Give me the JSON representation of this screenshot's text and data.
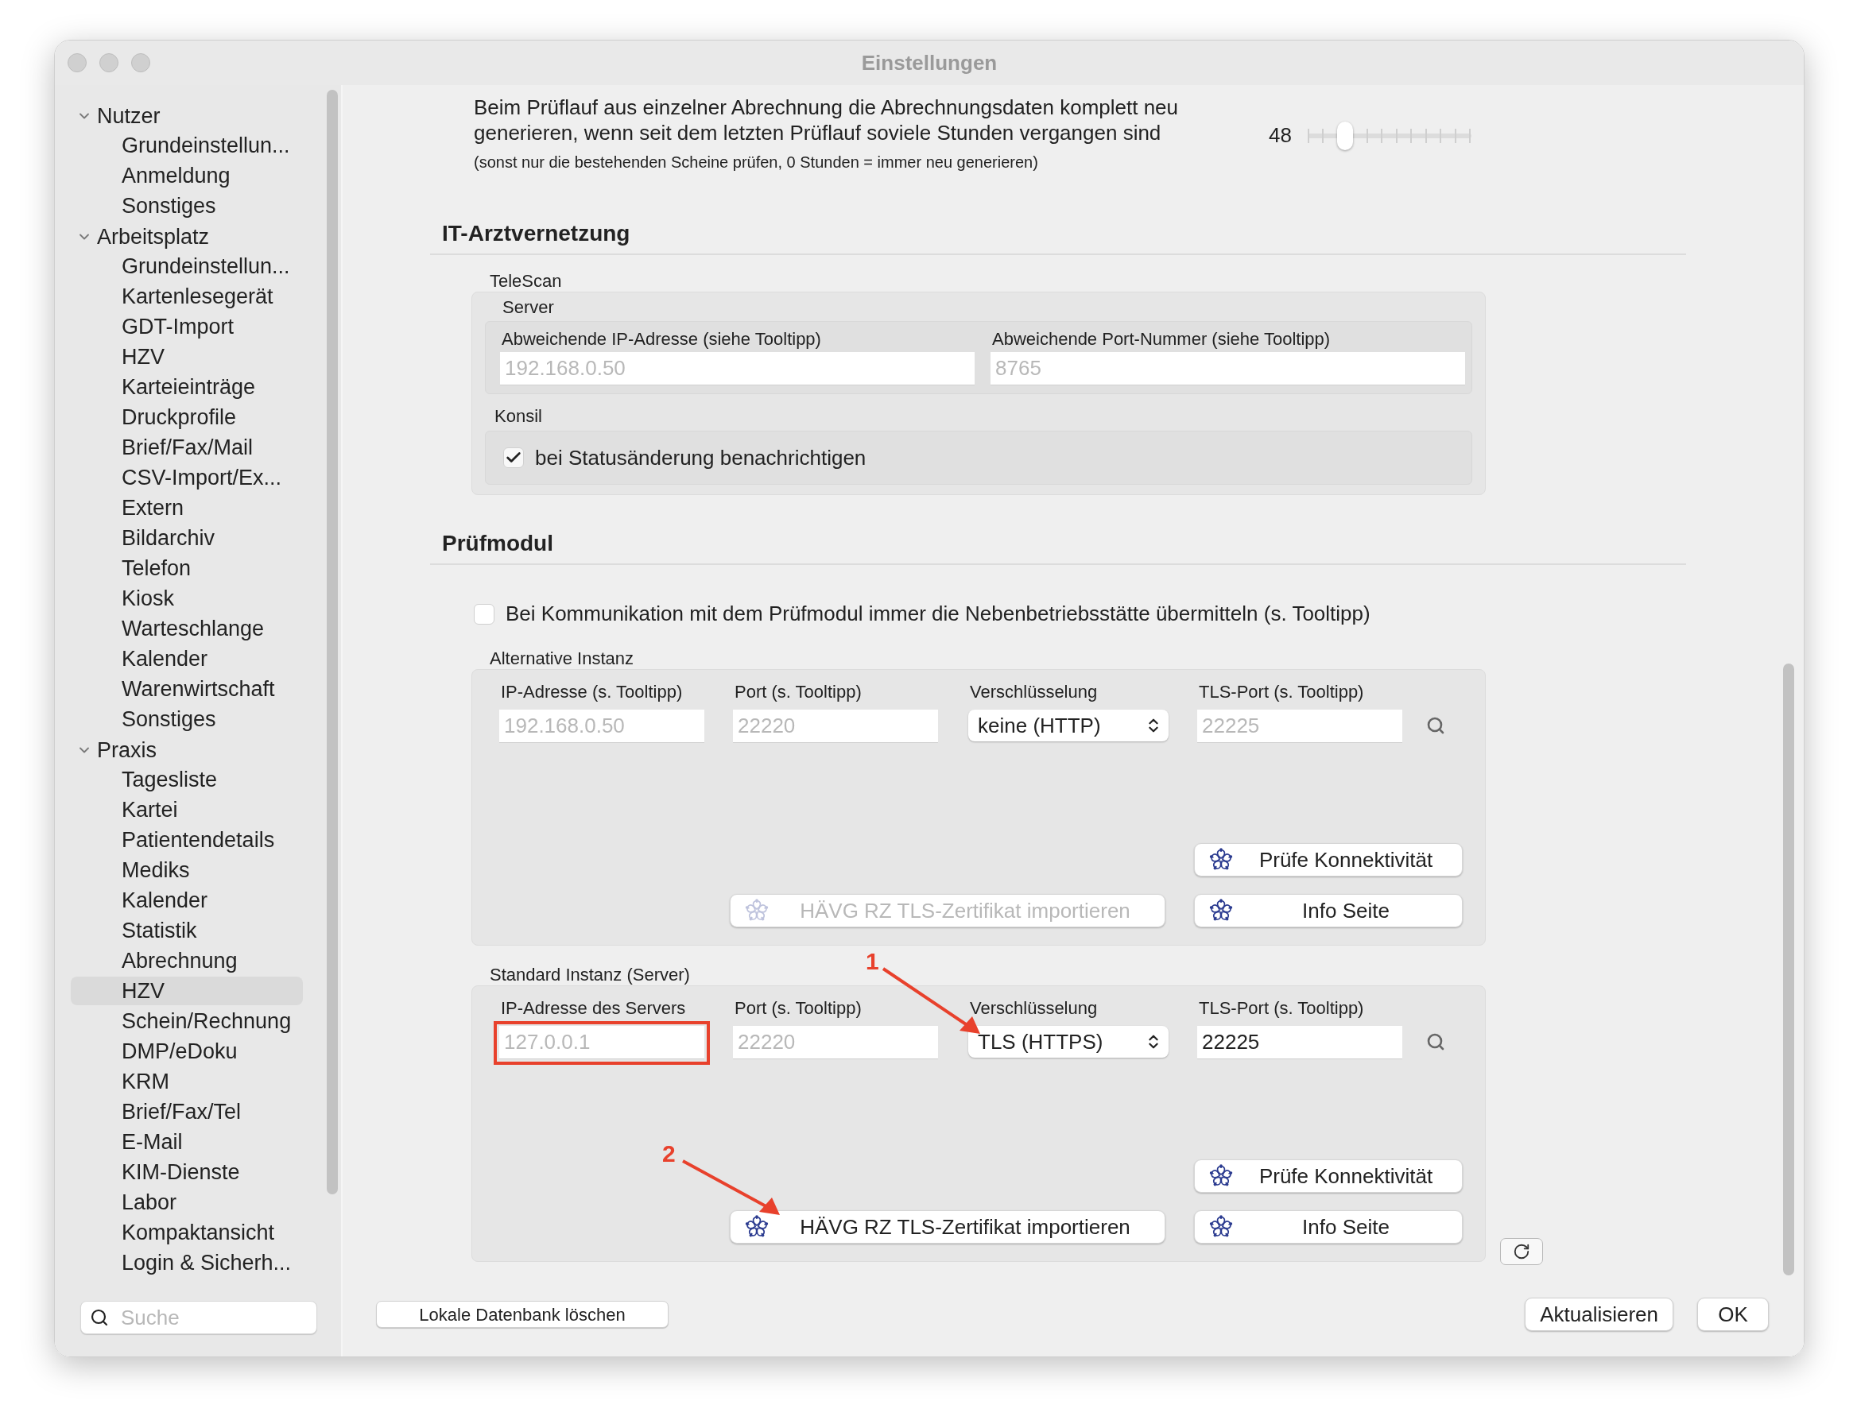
{
  "window": {
    "title": "Einstellungen"
  },
  "sidebar": {
    "groups": [
      {
        "label": "Nutzer",
        "expanded": true,
        "children": [
          {
            "label": "Grundeinstellun...",
            "selected": false
          },
          {
            "label": "Anmeldung",
            "selected": false
          },
          {
            "label": "Sonstiges",
            "selected": false
          }
        ]
      },
      {
        "label": "Arbeitsplatz",
        "expanded": true,
        "children": [
          {
            "label": "Grundeinstellun...",
            "selected": false
          },
          {
            "label": "Kartenlesegerät",
            "selected": false
          },
          {
            "label": "GDT-Import",
            "selected": false
          },
          {
            "label": "HZV",
            "selected": false
          },
          {
            "label": "Karteieinträge",
            "selected": false
          },
          {
            "label": "Druckprofile",
            "selected": false
          },
          {
            "label": "Brief/Fax/Mail",
            "selected": false
          },
          {
            "label": "CSV-Import/Ex...",
            "selected": false
          },
          {
            "label": "Extern",
            "selected": false
          },
          {
            "label": "Bildarchiv",
            "selected": false
          },
          {
            "label": "Telefon",
            "selected": false
          },
          {
            "label": "Kiosk",
            "selected": false
          },
          {
            "label": "Warteschlange",
            "selected": false
          },
          {
            "label": "Kalender",
            "selected": false
          },
          {
            "label": "Warenwirtschaft",
            "selected": false
          },
          {
            "label": "Sonstiges",
            "selected": false
          }
        ]
      },
      {
        "label": "Praxis",
        "expanded": true,
        "children": [
          {
            "label": "Tagesliste",
            "selected": false
          },
          {
            "label": "Kartei",
            "selected": false
          },
          {
            "label": "Patientendetails",
            "selected": false
          },
          {
            "label": "Mediks",
            "selected": false
          },
          {
            "label": "Kalender",
            "selected": false
          },
          {
            "label": "Statistik",
            "selected": false
          },
          {
            "label": "Abrechnung",
            "selected": false
          },
          {
            "label": "HZV",
            "selected": true
          },
          {
            "label": "Schein/Rechnung",
            "selected": false
          },
          {
            "label": "DMP/eDoku",
            "selected": false
          },
          {
            "label": "KRM",
            "selected": false
          },
          {
            "label": "Brief/Fax/Tel",
            "selected": false
          },
          {
            "label": "E-Mail",
            "selected": false
          },
          {
            "label": "KIM-Dienste",
            "selected": false
          },
          {
            "label": "Labor",
            "selected": false
          },
          {
            "label": "Kompaktansicht",
            "selected": false
          },
          {
            "label": "Login & Sicherh...",
            "selected": false
          }
        ]
      }
    ],
    "search": {
      "placeholder": "Suche"
    }
  },
  "regeneration": {
    "lines": [
      "Beim Prüflauf aus einzelner Abrechnung die Abrechnungsdaten komplett neu",
      "generieren, wenn seit dem letzten Prüflauf soviele Stunden vergangen sind"
    ],
    "note": "(sonst nur die bestehenden Scheine prüfen, 0 Stunden = immer neu generieren)",
    "value": "48",
    "level": 0.15
  },
  "it_arztvernetzung": {
    "title": "IT-Arztvernetzung",
    "telescan": {
      "title": "TeleScan",
      "server": {
        "title": "Server",
        "fields": [
          {
            "label": "Abweichende IP-Adresse (siehe Tooltipp)",
            "placeholder": "192.168.0.50"
          },
          {
            "label": "Abweichende Port-Nummer (siehe Tooltipp)",
            "placeholder": "8765"
          }
        ]
      },
      "konsil": {
        "title": "Konsil",
        "checkbox": {
          "label": "bei Statusänderung benachrichtigen",
          "checked": true
        }
      }
    }
  },
  "pruefmodul": {
    "title": "Prüfmodul",
    "checkbox": {
      "label": "Bei Kommunikation mit dem Prüfmodul immer die Nebenbetriebsstätte übermitteln (s. Tooltipp)",
      "checked": false
    },
    "instances": [
      {
        "title": "Alternative Instanz",
        "ip": {
          "label": "IP-Adresse (s. Tooltipp)",
          "placeholder": "192.168.0.50",
          "highlighted": false
        },
        "port": {
          "label": "Port (s. Tooltipp)",
          "placeholder": "22220"
        },
        "encryption": {
          "label": "Verschlüsselung",
          "value": "keine (HTTP)"
        },
        "tls_port": {
          "label": "TLS-Port (s. Tooltipp)",
          "placeholder": "22225"
        },
        "check_button": {
          "label": "Prüfe Konnektivität",
          "disabled": false
        },
        "import_button": {
          "label": "HÄVG RZ TLS-Zertifikat importieren",
          "disabled": true
        },
        "info_button": {
          "label": "Info Seite",
          "disabled": false
        }
      },
      {
        "title": "Standard Instanz (Server)",
        "ip": {
          "label": "IP-Adresse des Servers",
          "placeholder": "127.0.0.1",
          "highlighted": true
        },
        "port": {
          "label": "Port (s. Tooltipp)",
          "placeholder": "22220"
        },
        "encryption": {
          "label": "Verschlüsselung",
          "value": "TLS (HTTPS)"
        },
        "tls_port": {
          "label": "TLS-Port (s. Tooltipp)",
          "value": "22225"
        },
        "check_button": {
          "label": "Prüfe Konnektivität",
          "disabled": false
        },
        "import_button": {
          "label": "HÄVG RZ TLS-Zertifikat importieren",
          "disabled": false
        },
        "info_button": {
          "label": "Info Seite",
          "disabled": false
        }
      }
    ]
  },
  "annotations": [
    {
      "label": "1"
    },
    {
      "label": "2"
    }
  ],
  "footer": {
    "left_button": "Lokale Datenbank löschen",
    "buttons": [
      "Aktualisieren",
      "OK"
    ]
  }
}
